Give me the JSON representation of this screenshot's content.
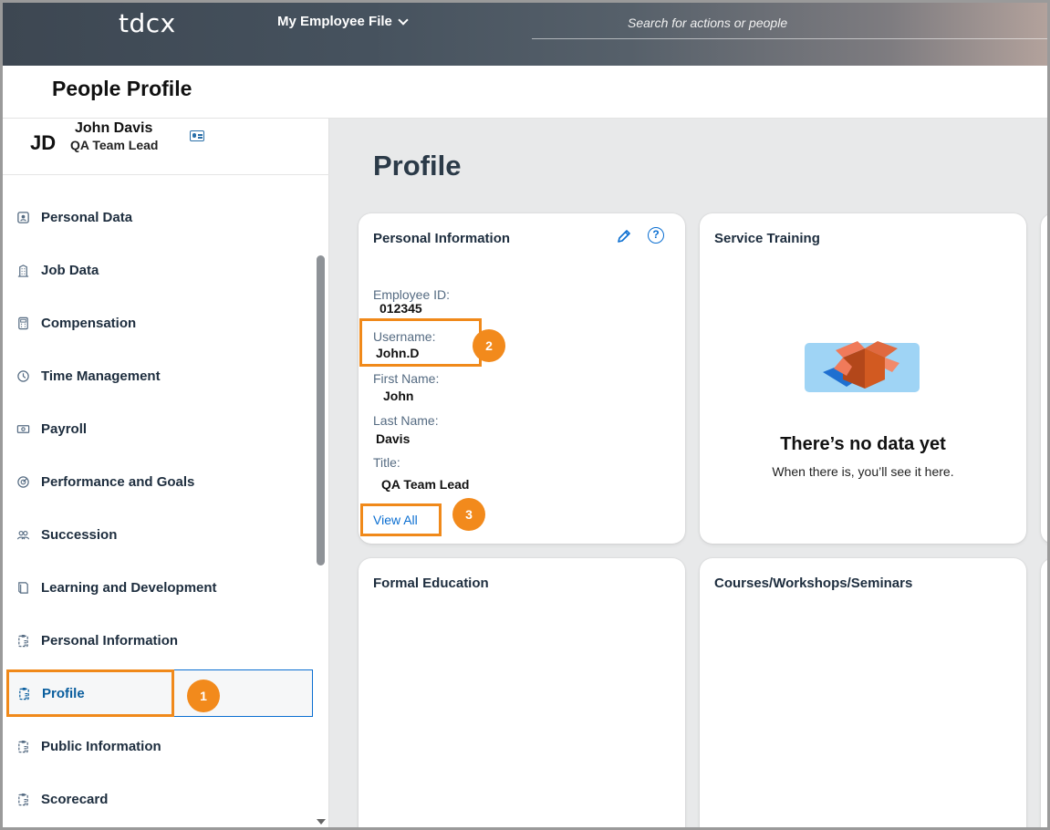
{
  "header": {
    "logo": "tdcx",
    "menu_title": "My Employee File",
    "search_placeholder": "Search for actions or people"
  },
  "page": {
    "title": "People Profile"
  },
  "user": {
    "initials": "JD",
    "name": "John Davis",
    "title": "QA Team Lead"
  },
  "sidebar": {
    "items": [
      {
        "label": "Personal Data",
        "icon": "contact-icon"
      },
      {
        "label": "Job Data",
        "icon": "building-icon"
      },
      {
        "label": "Compensation",
        "icon": "calculator-icon"
      },
      {
        "label": "Time Management",
        "icon": "clock-icon"
      },
      {
        "label": "Payroll",
        "icon": "money-bills-icon"
      },
      {
        "label": "Performance and Goals",
        "icon": "target-icon"
      },
      {
        "label": "Succession",
        "icon": "group-icon"
      },
      {
        "label": "Learning and Development",
        "icon": "book-icon"
      },
      {
        "label": "Personal Information",
        "icon": "clipboard-list-icon"
      },
      {
        "label": "Profile",
        "icon": "clipboard-list-icon",
        "active": true
      },
      {
        "label": "Public Information",
        "icon": "clipboard-list-icon"
      },
      {
        "label": "Scorecard",
        "icon": "clipboard-list-icon"
      }
    ]
  },
  "main": {
    "title": "Profile",
    "personal_info": {
      "title": "Personal Information",
      "fields": [
        {
          "label": "Employee ID:",
          "value": "012345"
        },
        {
          "label": "Username:",
          "value": "John.D"
        },
        {
          "label": "First Name:",
          "value": "John"
        },
        {
          "label": "Last Name:",
          "value": "Davis"
        },
        {
          "label": "Title:",
          "value": "QA Team Lead"
        }
      ],
      "view_all": "View All"
    },
    "service_training": {
      "title": "Service Training",
      "empty_title": "There’s no data yet",
      "empty_sub": "When there is, you’ll see it here."
    },
    "formal_education": {
      "title": "Formal Education"
    },
    "courses": {
      "title": "Courses/Workshops/Seminars"
    }
  },
  "annotations": {
    "badge1": "1",
    "badge2": "2",
    "badge3": "3"
  },
  "colors": {
    "accent": "#0a6ed1",
    "annotation": "#f28a1c"
  }
}
